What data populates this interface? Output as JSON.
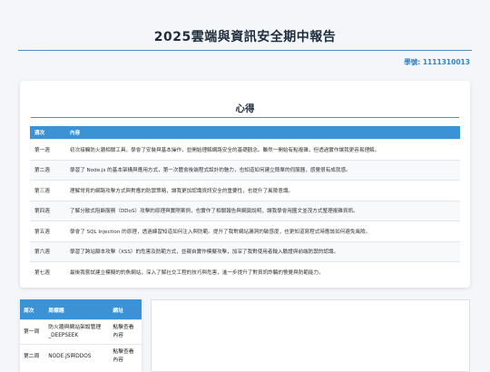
{
  "report": {
    "title": "2025雲端與資訊安全期中報告",
    "student_id": "學號: 1111310013"
  },
  "reflection": {
    "heading": "心得",
    "columns": [
      "週次",
      "內容"
    ],
    "rows": [
      {
        "week": "第一週",
        "content": "初次接觸防火牆相關工具，學會了安裝與基本操作，並開始理解網路安全的基礎觀念。雖然一開始有點複雜，但透過實作讓我更容易理解。"
      },
      {
        "week": "第二週",
        "content": "學習了 Node.js 的基本架構與應用方式，第一次體會後端程式設計的魅力，也知道如何建立簡單的伺服器，感覺很有成就感。"
      },
      {
        "week": "第三週",
        "content": "理解常見的網路攻擊方式與對應的防禦策略，讓我更加認識資訊安全的重要性，也提升了風險意識。"
      },
      {
        "week": "第四週",
        "content": "了解分散式阻斷服務（DDoS）攻擊的原理與實際案例，也實作了相關報告與網頁說明，讓我學會用圖文並茂方式整理複雜資訊。"
      },
      {
        "week": "第五週",
        "content": "學會了 SQL Injection 的原理，透過練習知道如何注入與防範。提升了我對網站漏洞的敏感度，也更知道寫程式時應該如何避免風險。"
      },
      {
        "week": "第六週",
        "content": "學習了跨站腳本攻擊（XSS）的危害及防範方式，並親自實作模擬攻擊，加深了我對使用者輸入驗證與前端防禦的認識。"
      },
      {
        "week": "第七週",
        "content": "最後我嘗試建立模擬的釣魚網站，深入了解社交工程的技巧與危害，進一步提升了對資訊詐騙的警覺與防範能力。"
      }
    ]
  },
  "links_table": {
    "columns": [
      "周次",
      "周標題",
      "網址"
    ],
    "rows": [
      {
        "week": "第一周",
        "title": "防火牆與網站架設管理_DEEPSEEK",
        "link": "點擊查看內容"
      },
      {
        "week": "第二周",
        "title": "NODE.JS與DDOS",
        "link": "點擊查看內容"
      }
    ]
  },
  "colors": {
    "accent": "#3b93d6",
    "title_text": "#1f2d3d",
    "student_text": "#2f86c7",
    "background": "#f4f6f9"
  }
}
